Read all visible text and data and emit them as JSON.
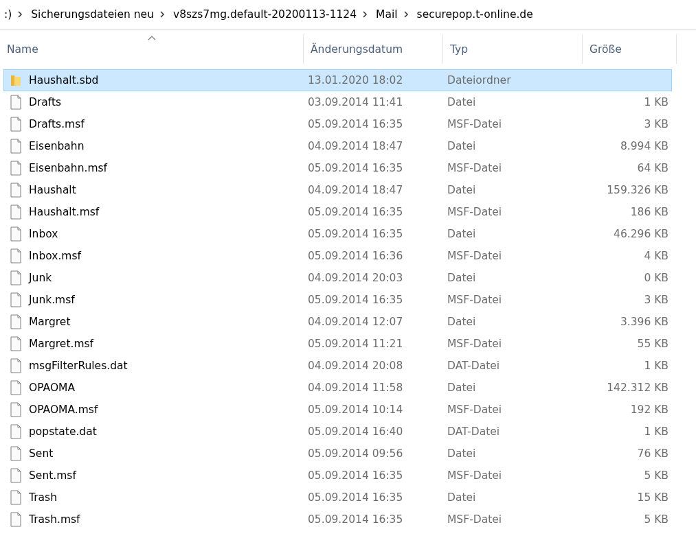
{
  "breadcrumb": [
    ":)",
    "Sicherungsdateien neu",
    "v8szs7mg.default-20200113-1124",
    "Mail",
    "securepop.t-online.de"
  ],
  "table": {
    "columns": [
      {
        "label": "Name",
        "sorted": true
      },
      {
        "label": "Änderungsdatum",
        "sorted": false
      },
      {
        "label": "Typ",
        "sorted": false
      },
      {
        "label": "Größe",
        "sorted": false
      }
    ],
    "rows": [
      {
        "kind": "folder",
        "name": "Haushalt.sbd",
        "date": "13.01.2020 18:02",
        "type": "Dateiordner",
        "selected": true
      },
      {
        "kind": "file",
        "name": "Drafts",
        "date": "03.09.2014 11:41",
        "type": "Datei",
        "size": "1 KB",
        "selected": false
      },
      {
        "kind": "file",
        "name": "Drafts.msf",
        "date": "05.09.2014 16:35",
        "type": "MSF-Datei",
        "size": "3 KB",
        "selected": false
      },
      {
        "kind": "file",
        "name": "Eisenbahn",
        "date": "04.09.2014 18:47",
        "type": "Datei",
        "size": "8.994 KB",
        "selected": false
      },
      {
        "kind": "file",
        "name": "Eisenbahn.msf",
        "date": "05.09.2014 16:35",
        "type": "MSF-Datei",
        "size": "64 KB",
        "selected": false
      },
      {
        "kind": "file",
        "name": "Haushalt",
        "date": "04.09.2014 18:47",
        "type": "Datei",
        "size": "159.326 KB",
        "selected": false
      },
      {
        "kind": "file",
        "name": "Haushalt.msf",
        "date": "05.09.2014 16:35",
        "type": "MSF-Datei",
        "size": "186 KB",
        "selected": false
      },
      {
        "kind": "file",
        "name": "Inbox",
        "date": "05.09.2014 16:35",
        "type": "Datei",
        "size": "46.296 KB",
        "selected": false
      },
      {
        "kind": "file",
        "name": "Inbox.msf",
        "date": "05.09.2014 16:36",
        "type": "MSF-Datei",
        "size": "4 KB",
        "selected": false
      },
      {
        "kind": "file",
        "name": "Junk",
        "date": "04.09.2014 20:03",
        "type": "Datei",
        "size": "0 KB",
        "selected": false
      },
      {
        "kind": "file",
        "name": "Junk.msf",
        "date": "05.09.2014 16:35",
        "type": "MSF-Datei",
        "size": "3 KB",
        "selected": false
      },
      {
        "kind": "file",
        "name": "Margret",
        "date": "04.09.2014 12:07",
        "type": "Datei",
        "size": "3.396 KB",
        "selected": false
      },
      {
        "kind": "file",
        "name": "Margret.msf",
        "date": "05.09.2014 11:21",
        "type": "MSF-Datei",
        "size": "55 KB",
        "selected": false
      },
      {
        "kind": "file",
        "name": "msgFilterRules.dat",
        "date": "04.09.2014 20:08",
        "type": "DAT-Datei",
        "size": "1 KB",
        "selected": false
      },
      {
        "kind": "file",
        "name": "OPAOMA",
        "date": "04.09.2014 11:58",
        "type": "Datei",
        "size": "142.312 KB",
        "selected": false
      },
      {
        "kind": "file",
        "name": "OPAOMA.msf",
        "date": "05.09.2014 10:14",
        "type": "MSF-Datei",
        "size": "192 KB",
        "selected": false
      },
      {
        "kind": "file",
        "name": "popstate.dat",
        "date": "05.09.2014 16:40",
        "type": "DAT-Datei",
        "size": "1 KB",
        "selected": false
      },
      {
        "kind": "file",
        "name": "Sent",
        "date": "05.09.2014 09:56",
        "type": "Datei",
        "size": "76 KB",
        "selected": false
      },
      {
        "kind": "file",
        "name": "Sent.msf",
        "date": "05.09.2014 16:35",
        "type": "MSF-Datei",
        "size": "5 KB",
        "selected": false
      },
      {
        "kind": "file",
        "name": "Trash",
        "date": "05.09.2014 16:35",
        "type": "Datei",
        "size": "15 KB",
        "selected": false
      },
      {
        "kind": "file",
        "name": "Trash.msf",
        "date": "05.09.2014 16:35",
        "type": "MSF-Datei",
        "size": "5 KB",
        "selected": false
      }
    ]
  }
}
